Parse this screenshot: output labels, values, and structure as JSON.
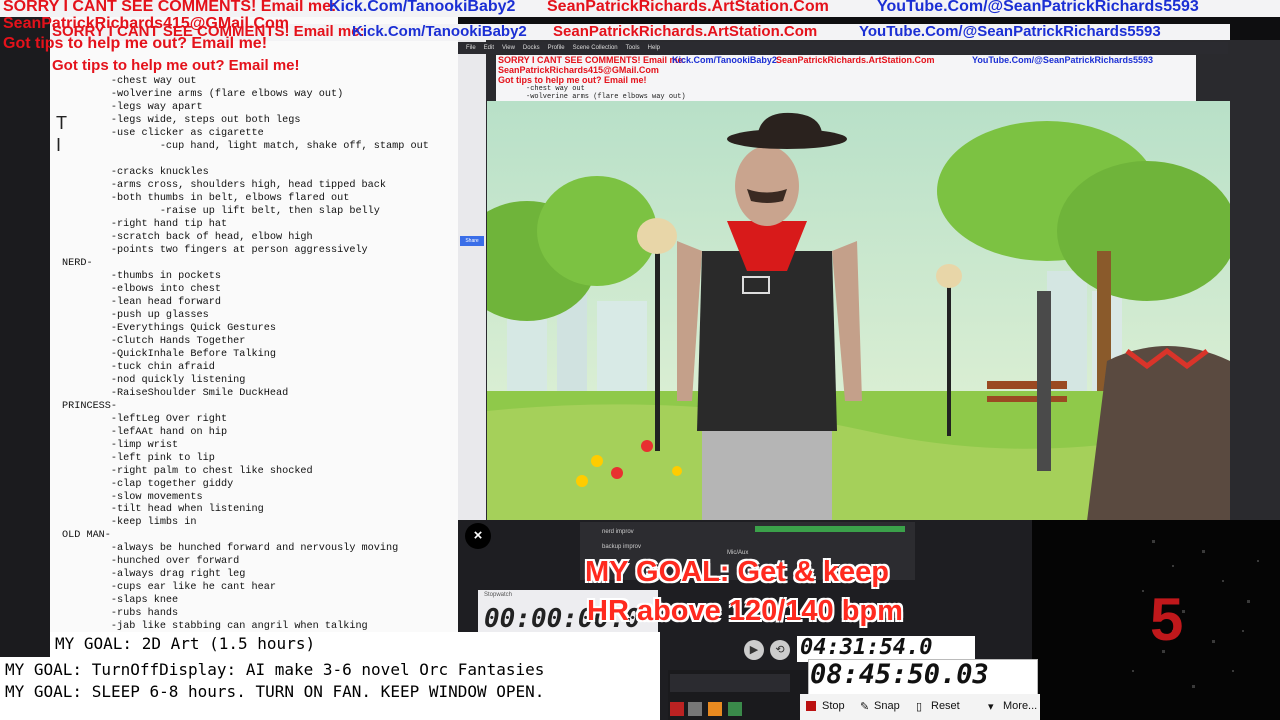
{
  "banners": {
    "sorry": "SORRY I CANT SEE COMMENTS! Email me:",
    "kick": "Kick.Com/TanookiBaby2",
    "artstation": "SeanPatrickRichards.ArtStation.Com",
    "youtube": "YouTube.Com/@SeanPatrickRichards5593",
    "email": "SeanPatrickRichards415@GMail.Com",
    "tips": "Got tips to help me out? Email me!"
  },
  "notes": {
    "peek": "T\nI",
    "lines": [
      "        -chest way out",
      "        -wolverine arms (flare elbows way out)",
      "        -legs way apart",
      "        -legs wide, steps out both legs",
      "        -use clicker as cigarette",
      "                -cup hand, light match, shake off, stamp out",
      "",
      "        -cracks knuckles",
      "        -arms cross, shoulders high, head tipped back",
      "        -both thumbs in belt, elbows flared out",
      "                -raise up lift belt, then slap belly",
      "        -right hand tip hat",
      "        -scratch back of head, elbow high",
      "        -points two fingers at person aggressively",
      "NERD-",
      "        -thumbs in pockets",
      "        -elbows into chest",
      "        -lean head forward",
      "        -push up glasses",
      "        -Everythings Quick Gestures",
      "        -Clutch Hands Together",
      "        -QuickInhale Before Talking",
      "        -tuck chin afraid",
      "        -nod quickly listening",
      "        -RaiseShoulder Smile DuckHead",
      "PRINCESS-",
      "        -leftLeg Over right",
      "        -lefAAt hand on hip",
      "        -limp wrist",
      "        -left pink to lip",
      "        -right palm to chest like shocked",
      "        -clap together giddy",
      "        -slow movements",
      "        -tilt head when listening",
      "        -keep limbs in",
      "OLD MAN-",
      "        -always be hunched forward and nervously moving",
      "        -hunched over forward",
      "        -always drag right leg",
      "        -cups ear like he cant hear",
      "        -slaps knee",
      "        -rubs hands",
      "        -jab like stabbing can angril when talking"
    ]
  },
  "nested": {
    "menu": [
      "File",
      "Edit",
      "View",
      "Docks",
      "Profile",
      "Scene Collection",
      "Tools",
      "Help"
    ],
    "banner_line1": "SORRY I CANT SEE COMMENTS! Email me:",
    "banner_line2": "SeanPatrickRichards415@GMail.Com",
    "banner_line3": "Got tips to help me out? Email me!",
    "notes_line1": "-chest way out",
    "notes_line2": "-wolverine arms (flare elbows way out)",
    "sources": [
      "nerd improv",
      "backup improv"
    ],
    "mixer_label": "Mic/Aux",
    "share_label": "Share"
  },
  "overlay": {
    "goal_line1": "MY GOAL: Get & keep",
    "goal_line2": "HR above 120/140 bpm",
    "stopwatch_title": "Stopwatch",
    "stopwatch": "00:00:00.0",
    "timer_small": "04:31:54.0",
    "timer_big": "08:45:50.03",
    "hr_digit": "5",
    "close_symbol": "×"
  },
  "controls": {
    "stop": "Stop",
    "snap": "Snap",
    "reset": "Reset",
    "more": "More..."
  },
  "goals": {
    "art": "MY GOAL: 2D Art (1.5 hours)",
    "orc": "MY GOAL: TurnOffDisplay: AI make 3-6 novel Orc Fantasies",
    "sleep": "MY GOAL: SLEEP 6-8 hours. TURN ON FAN. KEEP WINDOW OPEN."
  },
  "colors": {
    "banner_red": "#e4121b",
    "banner_blue": "#1b2fd4",
    "goal_red": "#ff2a1f",
    "sky": "#cfe8c8",
    "grass": "#7fbf3a",
    "bandana": "#d81a1a"
  }
}
